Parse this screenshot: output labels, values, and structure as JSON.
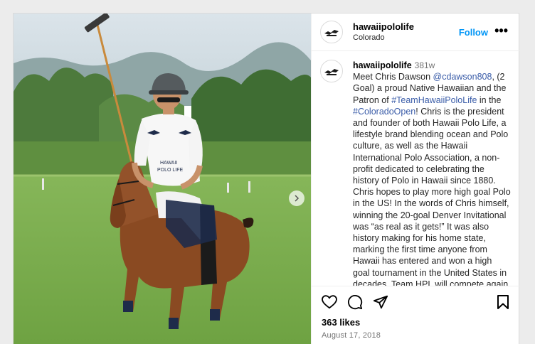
{
  "post": {
    "account": "hawaiipololife",
    "location": "Colorado",
    "follow_label": "Follow",
    "more_label": "•••",
    "caption": {
      "username": "hawaiipololife",
      "age": "381w",
      "parts": [
        {
          "text": "Meet Chris Dawson ",
          "link": false
        },
        {
          "text": "@cdawson808",
          "link": true
        },
        {
          "text": ", (2 Goal) a proud Native Hawaiian and the Patron of ",
          "link": false
        },
        {
          "text": "#TeamHawaiiPoloLife",
          "link": true
        },
        {
          "text": " in the ",
          "link": false
        },
        {
          "text": "#ColoradoOpen",
          "link": true
        },
        {
          "text": "! Chris is the president and founder of both Hawaii Polo Life, a lifestyle brand blending ocean and Polo culture, as well as the Hawaii International Polo Association, a non-profit dedicated to celebrating the history of Polo in Hawaii since 1880. Chris hopes to play more high goal Polo in the US! In the words of Chris himself, winning the 20-goal Denver Invitational was “as real as it gets!” It was also history making for his home state, marking the first time anyone from Hawaii has entered and won a high goal tournament in the United States in decades. Team HPL will compete again tomorrow in the drama the ...",
          "link": false
        }
      ]
    },
    "likes": "363 likes",
    "date": "August 17, 2018",
    "jersey_text": "HAWAII\nPOLO LIFE",
    "colors": {
      "link": "#3a5ca8",
      "follow": "#0095f6",
      "grass": "#7fb04e",
      "horse": "#8a4a22"
    }
  }
}
